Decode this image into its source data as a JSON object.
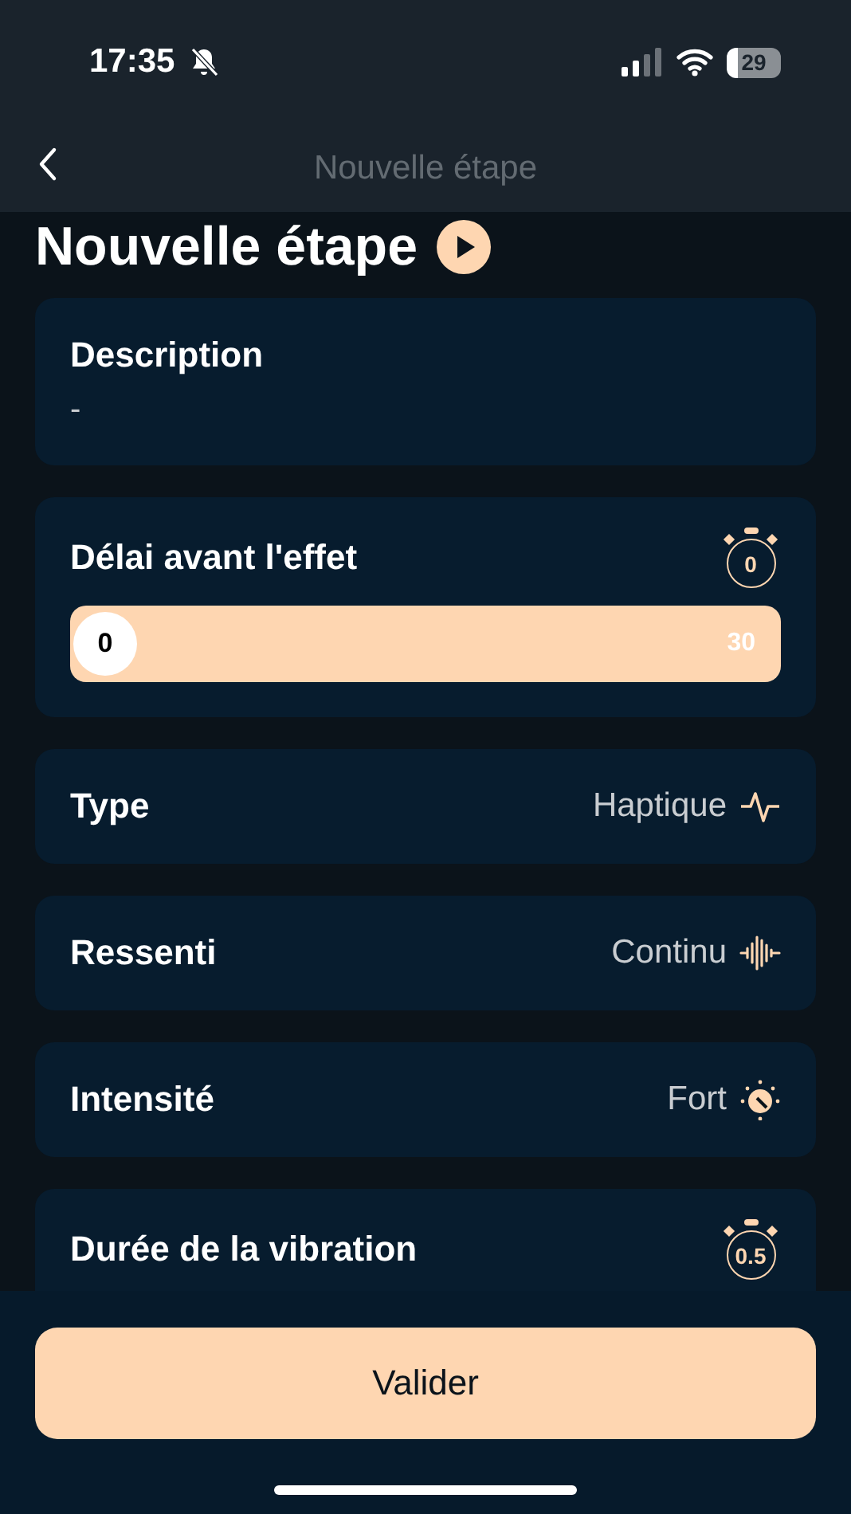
{
  "status_bar": {
    "time": "17:35",
    "silent": true,
    "battery": "29"
  },
  "nav_bar": {
    "title": "Nouvelle étape"
  },
  "page": {
    "heading": "Nouvelle étape"
  },
  "rows": [
    {
      "kind": "text",
      "label": "Description",
      "value": "-"
    },
    {
      "kind": "slider",
      "label": "Délai avant l'effet",
      "timer": "0",
      "thumb": "0",
      "max": "30",
      "level": 0
    },
    {
      "kind": "choice",
      "label": "Type",
      "value": "Haptique"
    },
    {
      "kind": "choice",
      "label": "Ressenti",
      "value": "Continu"
    },
    {
      "kind": "choice",
      "label": "Intensité",
      "value": "Fort"
    },
    {
      "kind": "slider",
      "label": "Durée de la vibration",
      "timer": "0.5"
    }
  ],
  "button": {
    "label": "Valider"
  }
}
